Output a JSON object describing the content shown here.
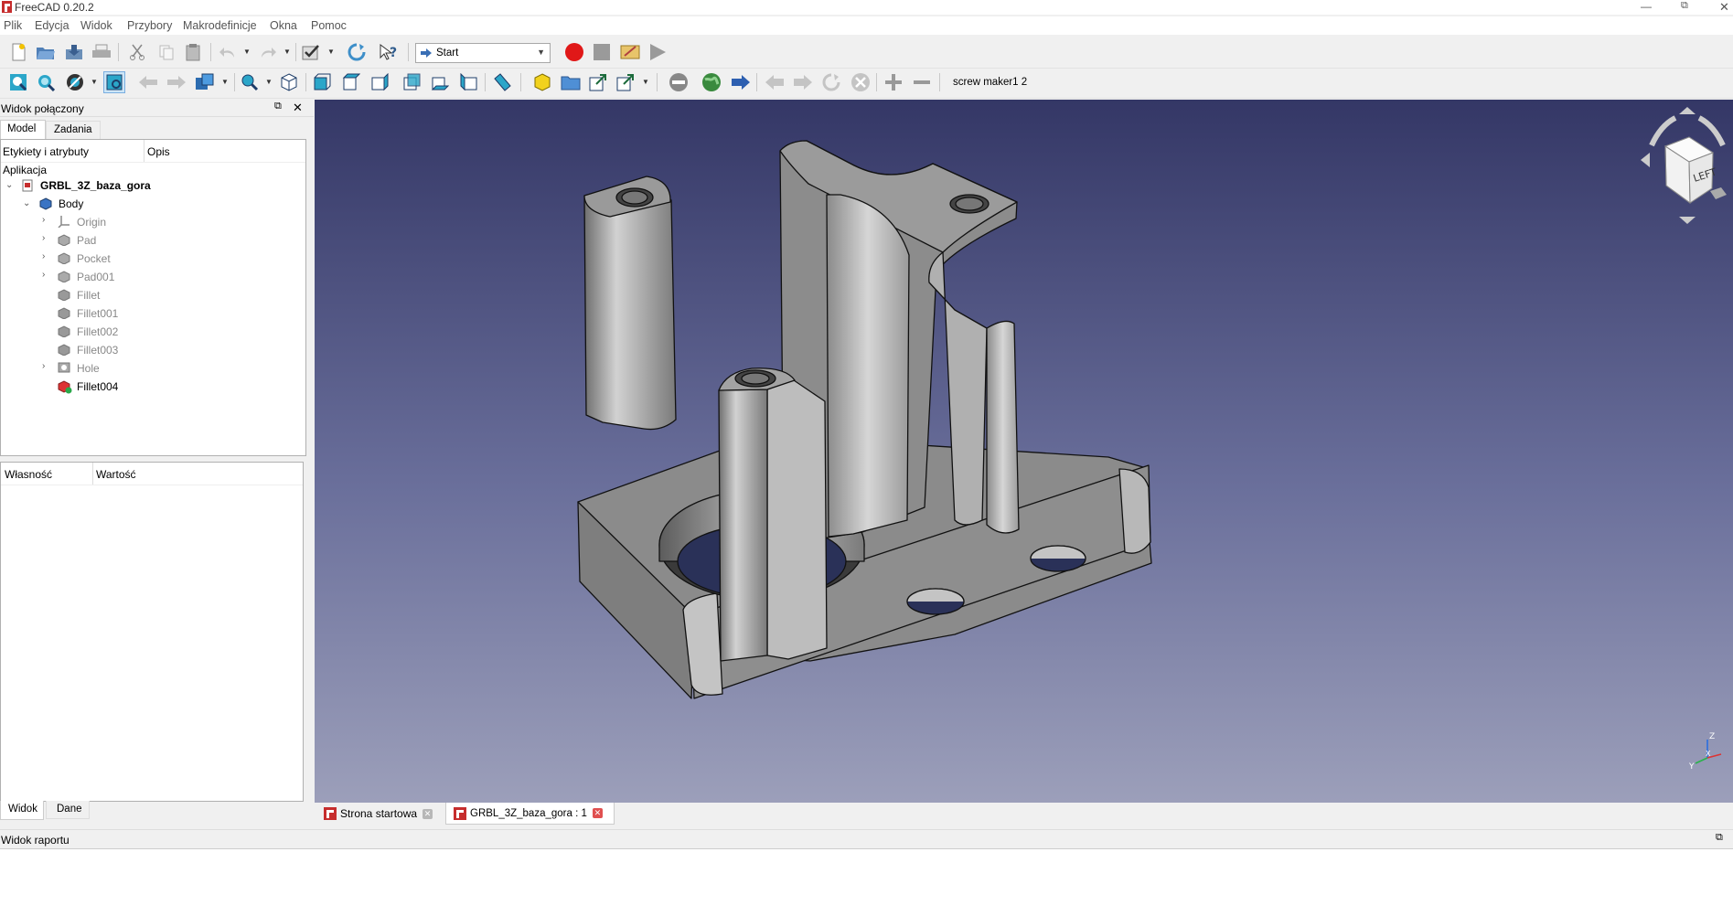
{
  "window": {
    "title": "FreeCAD 0.20.2"
  },
  "menu": [
    "Plik",
    "Edycja",
    "Widok",
    "Przybory",
    "Makrodefinicje",
    "Okna",
    "Pomoc"
  ],
  "toolbar": {
    "workbench": "Start",
    "macro_label": "screw maker1 2"
  },
  "combo_view": {
    "title": "Widok połączony",
    "tabs": [
      "Model",
      "Zadania"
    ],
    "columns": [
      "Etykiety i atrybuty",
      "Opis"
    ],
    "section": "Aplikacja",
    "document": "GRBL_3Z_baza_gora",
    "body": "Body",
    "features": [
      {
        "label": "Origin",
        "expandable": true
      },
      {
        "label": "Pad",
        "expandable": true
      },
      {
        "label": "Pocket",
        "expandable": true
      },
      {
        "label": "Pad001",
        "expandable": true
      },
      {
        "label": "Fillet",
        "expandable": false
      },
      {
        "label": "Fillet001",
        "expandable": false
      },
      {
        "label": "Fillet002",
        "expandable": false
      },
      {
        "label": "Fillet003",
        "expandable": false
      },
      {
        "label": "Hole",
        "expandable": true
      },
      {
        "label": "Fillet004",
        "expandable": false
      }
    ]
  },
  "property_view": {
    "columns": [
      "Własność",
      "Wartość"
    ],
    "tabs": [
      "Widok",
      "Dane"
    ]
  },
  "nav_cube": {
    "face": "LEFT"
  },
  "axis": {
    "x": "X",
    "y": "Y",
    "z": "Z"
  },
  "doc_tabs": [
    {
      "label": "Strona startowa"
    },
    {
      "label": "GRBL_3Z_baza_gora : 1"
    }
  ],
  "report_view": {
    "title": "Widok raportu"
  },
  "colors": {
    "viewport_top": "#343766",
    "viewport_bottom": "#9c9fba",
    "part": "#8a8a8a",
    "close_red": "#e05050"
  }
}
